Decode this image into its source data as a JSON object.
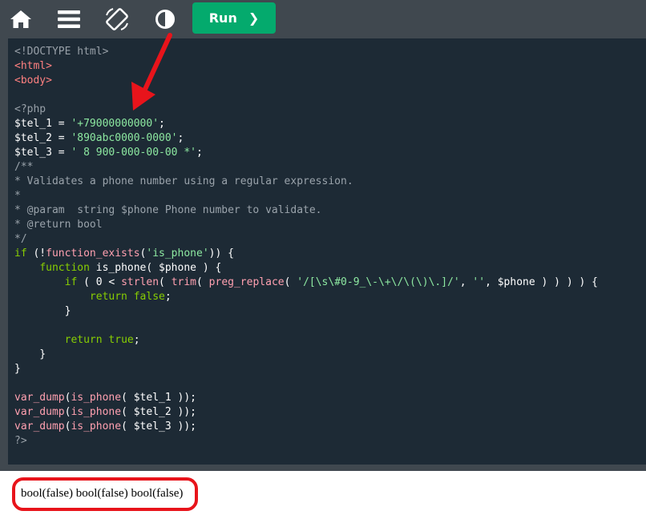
{
  "toolbar": {
    "icons": [
      "home-icon",
      "menu-icon",
      "rotate-icon",
      "contrast-icon"
    ],
    "run_label": "Run",
    "run_chevron": "❯",
    "run_color": "#04aa6d"
  },
  "editor": {
    "background": "#1d2a35",
    "lines": [
      [
        {
          "t": "<!DOCTYPE html>",
          "c": "meta"
        }
      ],
      [
        {
          "t": "<html>",
          "c": "tag"
        }
      ],
      [
        {
          "t": "<body>",
          "c": "tag"
        }
      ],
      [
        {
          "t": "",
          "c": "op"
        }
      ],
      [
        {
          "t": "<?php",
          "c": "meta"
        }
      ],
      [
        {
          "t": "$tel_1",
          "c": "var"
        },
        {
          "t": " = ",
          "c": "op"
        },
        {
          "t": "'+79000000000'",
          "c": "str2"
        },
        {
          "t": ";",
          "c": "op"
        }
      ],
      [
        {
          "t": "$tel_2",
          "c": "var"
        },
        {
          "t": " = ",
          "c": "op"
        },
        {
          "t": "'890abc0000-0000'",
          "c": "str2"
        },
        {
          "t": ";",
          "c": "op"
        }
      ],
      [
        {
          "t": "$tel_3",
          "c": "var"
        },
        {
          "t": " = ",
          "c": "op"
        },
        {
          "t": "' 8 900-000-00-00 *'",
          "c": "str2"
        },
        {
          "t": ";",
          "c": "op"
        }
      ],
      [
        {
          "t": "/**",
          "c": "comment"
        }
      ],
      [
        {
          "t": "* Validates a phone number using a regular expression.",
          "c": "comment"
        }
      ],
      [
        {
          "t": "*",
          "c": "comment"
        }
      ],
      [
        {
          "t": "* @param  string $phone Phone number to validate.",
          "c": "comment"
        }
      ],
      [
        {
          "t": "* @return bool",
          "c": "comment"
        }
      ],
      [
        {
          "t": "*/",
          "c": "comment"
        }
      ],
      [
        {
          "t": "if",
          "c": "kw"
        },
        {
          "t": " (!",
          "c": "op"
        },
        {
          "t": "function_exists",
          "c": "fn"
        },
        {
          "t": "(",
          "c": "op"
        },
        {
          "t": "'is_phone'",
          "c": "str2"
        },
        {
          "t": ")) {",
          "c": "op"
        }
      ],
      [
        {
          "t": "    ",
          "c": "op"
        },
        {
          "t": "function",
          "c": "kw"
        },
        {
          "t": " is_phone( ",
          "c": "op"
        },
        {
          "t": "$phone",
          "c": "var"
        },
        {
          "t": " ) {",
          "c": "op"
        }
      ],
      [
        {
          "t": "        ",
          "c": "op"
        },
        {
          "t": "if",
          "c": "kw"
        },
        {
          "t": " ( 0 < ",
          "c": "op"
        },
        {
          "t": "strlen",
          "c": "fn"
        },
        {
          "t": "( ",
          "c": "op"
        },
        {
          "t": "trim",
          "c": "fn"
        },
        {
          "t": "( ",
          "c": "op"
        },
        {
          "t": "preg_replace",
          "c": "fn"
        },
        {
          "t": "( ",
          "c": "op"
        },
        {
          "t": "'/[\\s\\#0-9_\\-\\+\\/\\(\\)\\.]/'",
          "c": "str2"
        },
        {
          "t": ", ",
          "c": "op"
        },
        {
          "t": "''",
          "c": "str2"
        },
        {
          "t": ", ",
          "c": "op"
        },
        {
          "t": "$phone",
          "c": "var"
        },
        {
          "t": " ) ) ) ) {",
          "c": "op"
        }
      ],
      [
        {
          "t": "            ",
          "c": "op"
        },
        {
          "t": "return false",
          "c": "kw"
        },
        {
          "t": ";",
          "c": "op"
        }
      ],
      [
        {
          "t": "        }",
          "c": "op"
        }
      ],
      [
        {
          "t": "",
          "c": "op"
        }
      ],
      [
        {
          "t": "        ",
          "c": "op"
        },
        {
          "t": "return true",
          "c": "kw"
        },
        {
          "t": ";",
          "c": "op"
        }
      ],
      [
        {
          "t": "    }",
          "c": "op"
        }
      ],
      [
        {
          "t": "}",
          "c": "op"
        }
      ],
      [
        {
          "t": "",
          "c": "op"
        }
      ],
      [
        {
          "t": "var_dump",
          "c": "fn"
        },
        {
          "t": "(",
          "c": "op"
        },
        {
          "t": "is_phone",
          "c": "fn"
        },
        {
          "t": "( ",
          "c": "op"
        },
        {
          "t": "$tel_1",
          "c": "var"
        },
        {
          "t": " ));",
          "c": "op"
        }
      ],
      [
        {
          "t": "var_dump",
          "c": "fn"
        },
        {
          "t": "(",
          "c": "op"
        },
        {
          "t": "is_phone",
          "c": "fn"
        },
        {
          "t": "( ",
          "c": "op"
        },
        {
          "t": "$tel_2",
          "c": "var"
        },
        {
          "t": " ));",
          "c": "op"
        }
      ],
      [
        {
          "t": "var_dump",
          "c": "fn"
        },
        {
          "t": "(",
          "c": "op"
        },
        {
          "t": "is_phone",
          "c": "fn"
        },
        {
          "t": "( ",
          "c": "op"
        },
        {
          "t": "$tel_3",
          "c": "var"
        },
        {
          "t": " ));",
          "c": "op"
        }
      ],
      [
        {
          "t": "?>",
          "c": "meta"
        }
      ]
    ]
  },
  "output": {
    "text": "bool(false) bool(false) bool(false)"
  },
  "annotations": {
    "color": "#e8141b"
  }
}
